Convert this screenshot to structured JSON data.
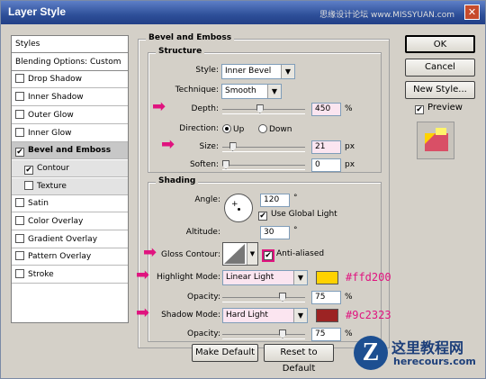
{
  "window": {
    "title": "Layer Style",
    "watermark_top": "思缘设计论坛  www.MISSYUAN.com",
    "close_label": "✕"
  },
  "style_list": [
    {
      "label": "Styles",
      "checkbox": false,
      "checked": false,
      "selected": false
    },
    {
      "label": "Blending Options: Custom",
      "checkbox": false,
      "checked": false,
      "selected": false
    },
    {
      "label": "Drop Shadow",
      "checkbox": true,
      "checked": false,
      "selected": false
    },
    {
      "label": "Inner Shadow",
      "checkbox": true,
      "checked": false,
      "selected": false
    },
    {
      "label": "Outer Glow",
      "checkbox": true,
      "checked": false,
      "selected": false
    },
    {
      "label": "Inner Glow",
      "checkbox": true,
      "checked": false,
      "selected": false
    },
    {
      "label": "Bevel and Emboss",
      "checkbox": true,
      "checked": true,
      "selected": true
    },
    {
      "label": "Contour",
      "checkbox": true,
      "checked": true,
      "selected": false,
      "sub": true
    },
    {
      "label": "Texture",
      "checkbox": true,
      "checked": false,
      "selected": false,
      "sub": true
    },
    {
      "label": "Satin",
      "checkbox": true,
      "checked": false,
      "selected": false
    },
    {
      "label": "Color Overlay",
      "checkbox": true,
      "checked": false,
      "selected": false
    },
    {
      "label": "Gradient Overlay",
      "checkbox": true,
      "checked": false,
      "selected": false
    },
    {
      "label": "Pattern Overlay",
      "checkbox": true,
      "checked": false,
      "selected": false
    },
    {
      "label": "Stroke",
      "checkbox": true,
      "checked": false,
      "selected": false
    }
  ],
  "bevel": {
    "title": "Bevel and Emboss",
    "structure_title": "Structure",
    "style_label": "Style:",
    "style_value": "Inner Bevel",
    "technique_label": "Technique:",
    "technique_value": "Smooth",
    "depth_label": "Depth:",
    "depth_value": "450",
    "depth_unit": "%",
    "depth_level": 0.45,
    "direction_label": "Direction:",
    "direction_up": "Up",
    "direction_down": "Down",
    "size_label": "Size:",
    "size_value": "21",
    "size_unit": "px",
    "size_level": 0.09,
    "soften_label": "Soften:",
    "soften_value": "0",
    "soften_unit": "px",
    "soften_level": 0.0
  },
  "shading": {
    "title": "Shading",
    "angle_label": "Angle:",
    "angle_value": "120",
    "angle_unit": "°",
    "global_light_label": "Use Global Light",
    "altitude_label": "Altitude:",
    "altitude_value": "30",
    "altitude_unit": "°",
    "gloss_label": "Gloss Contour:",
    "anti_aliased_label": "Anti-aliased",
    "highlight_label": "Highlight Mode:",
    "highlight_mode": "Linear Light",
    "highlight_color": "#ffd200",
    "highlight_hex": "#ffd200",
    "highlight_opacity_label": "Opacity:",
    "highlight_opacity": "75",
    "opacity_unit": "%",
    "shadow_label": "Shadow Mode:",
    "shadow_mode": "Hard Light",
    "shadow_color": "#9c2323",
    "shadow_hex": "#9c2323",
    "shadow_opacity_label": "Opacity:",
    "shadow_opacity": "75"
  },
  "buttons": {
    "make_default": "Make Default",
    "reset_default": "Reset to Default",
    "ok": "OK",
    "cancel": "Cancel",
    "new_style": "New Style...",
    "preview": "Preview"
  },
  "watermark": {
    "logo": "Z",
    "title": "这里教程网",
    "url": "herecours.com"
  }
}
